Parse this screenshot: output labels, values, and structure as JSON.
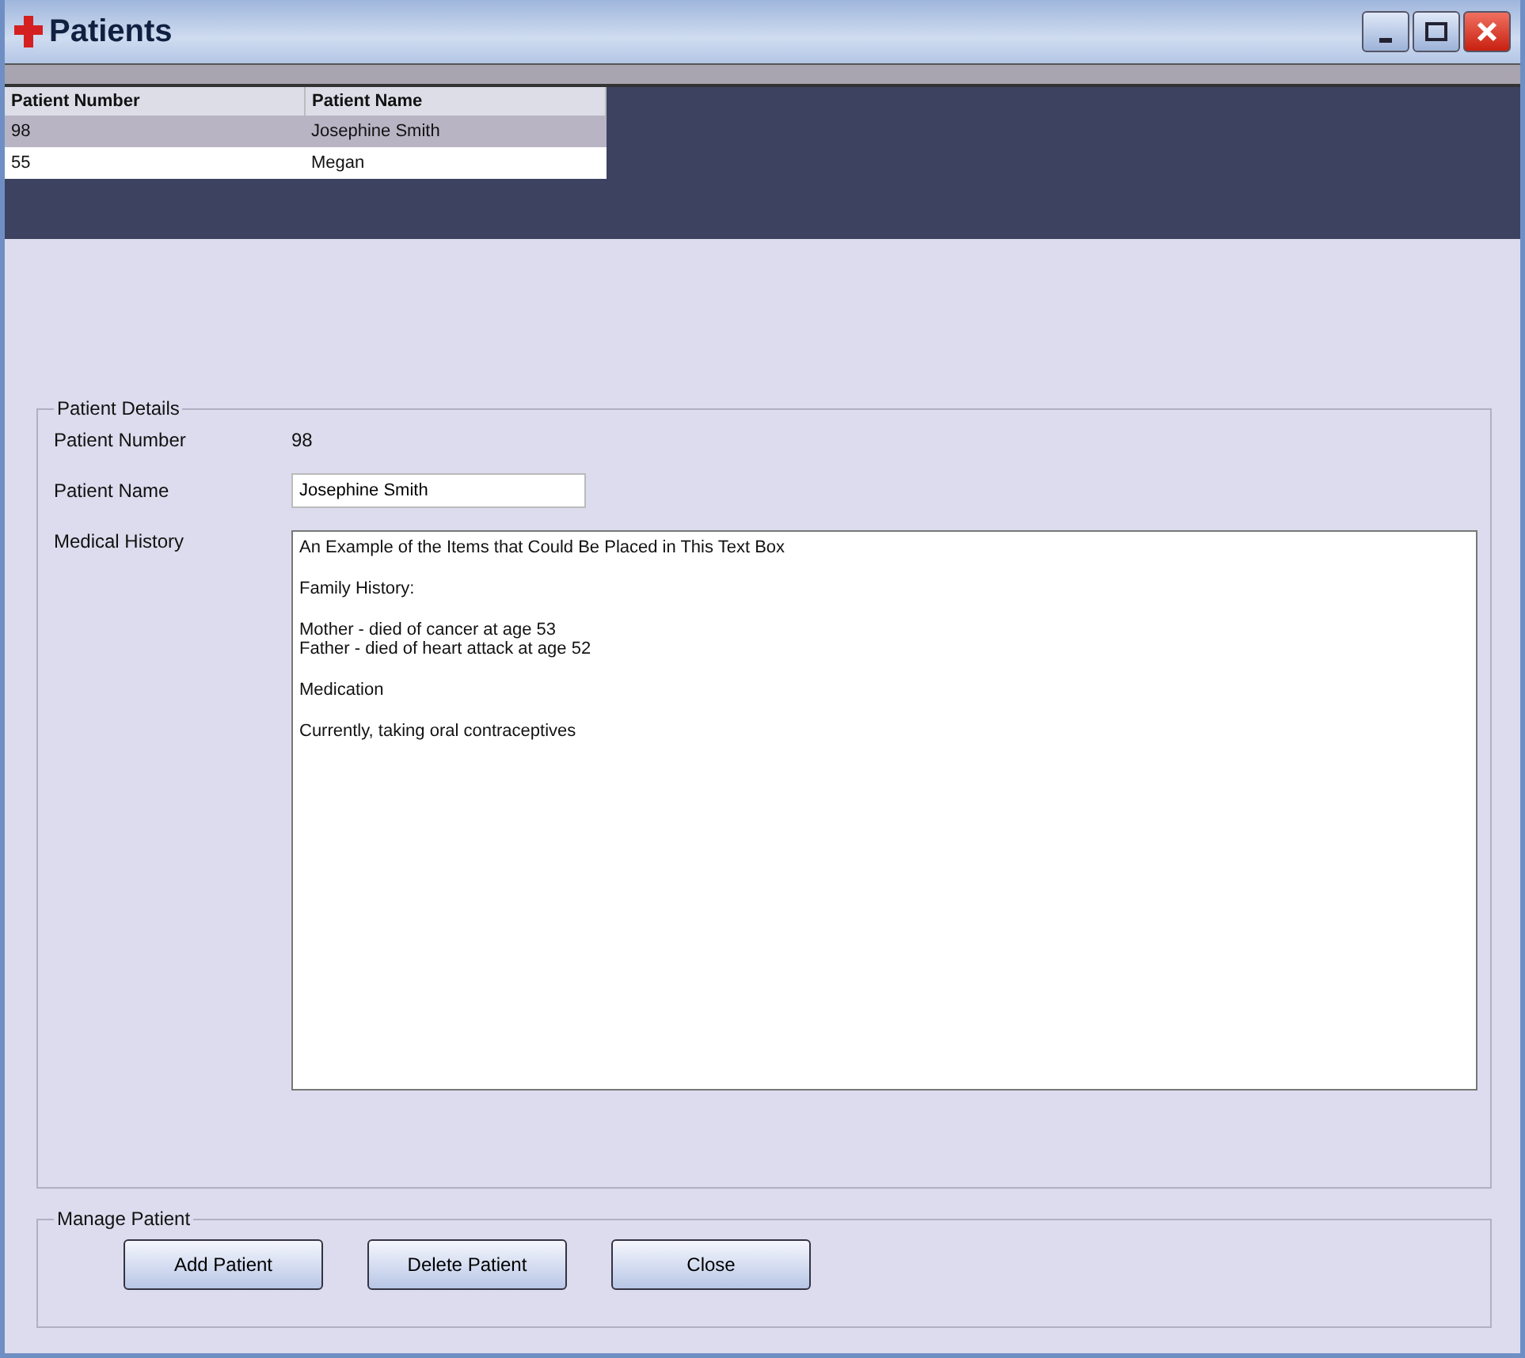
{
  "window": {
    "title": "Patients"
  },
  "grid": {
    "columns": [
      "Patient Number",
      "Patient Name"
    ],
    "rows": [
      {
        "cells": [
          "98",
          "Josephine Smith"
        ],
        "selected": true
      },
      {
        "cells": [
          "55",
          "Megan"
        ],
        "selected": false
      }
    ]
  },
  "details": {
    "title": "Patient Details",
    "number_label": "Patient Number",
    "number_value": "98",
    "name_label": "Patient Name",
    "name_value": "Josephine Smith",
    "history_label": "Medical History",
    "history": [
      [
        "An Example of the Items that Could Be Placed in This Text Box"
      ],
      [
        "Family History:"
      ],
      [
        "Mother - died of cancer at age 53",
        "Father - died of heart attack at age 52"
      ],
      [
        "Medication"
      ],
      [
        "Currently, taking oral contraceptives"
      ]
    ]
  },
  "manage": {
    "title": "Manage Patient",
    "buttons": [
      "Add Patient",
      "Delete Patient",
      "Close"
    ]
  }
}
